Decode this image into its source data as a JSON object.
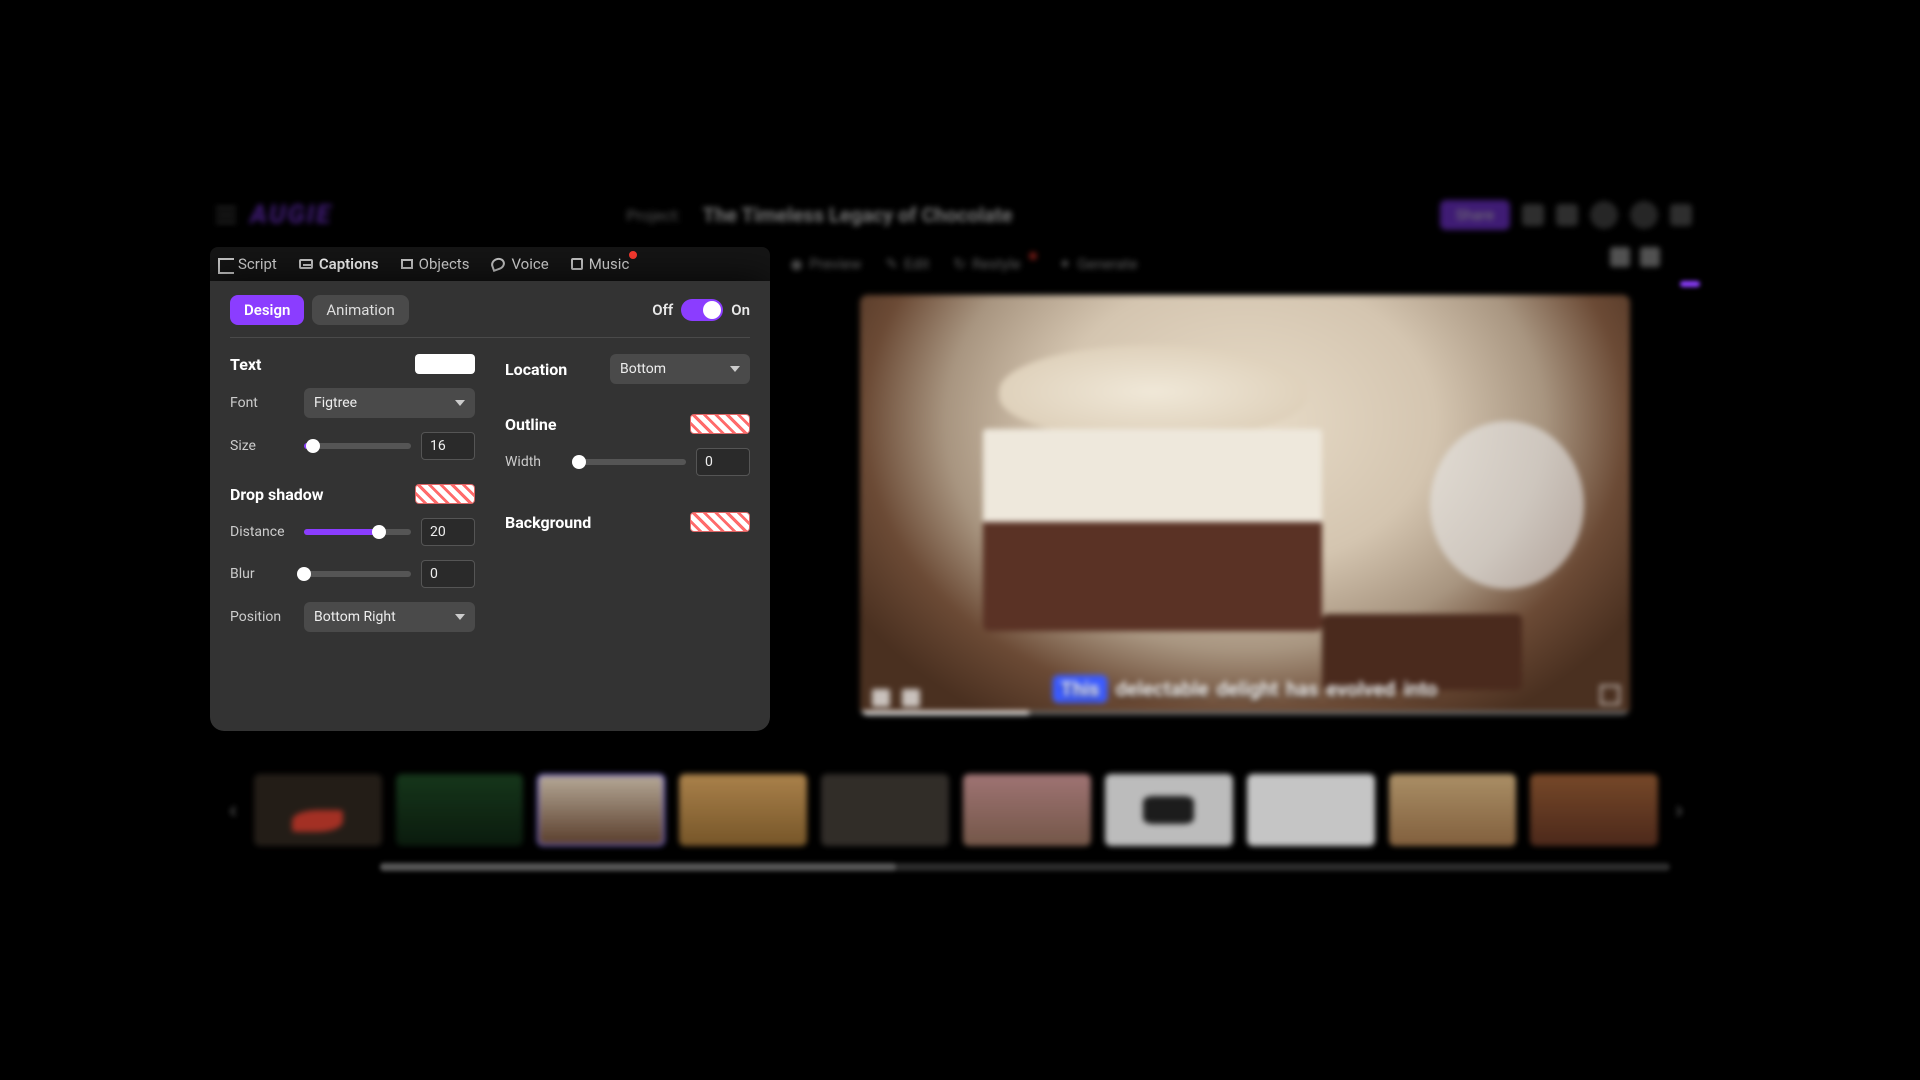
{
  "header": {
    "logo": "AUGIE",
    "project_label": "Project:",
    "project_title": "The Timeless Legacy of Chocolate",
    "share": "Share"
  },
  "tabs": {
    "script": "Script",
    "captions": "Captions",
    "objects": "Objects",
    "voice": "Voice",
    "music": "Music"
  },
  "preview_tabs": {
    "preview": "Preview",
    "edit": "Edit",
    "restyle": "Restyle",
    "generate": "Generate"
  },
  "panel": {
    "design": "Design",
    "animation": "Animation",
    "toggle_off": "Off",
    "toggle_on": "On",
    "toggle_state": true,
    "text": {
      "title": "Text",
      "font_label": "Font",
      "font_value": "Figtree",
      "size_label": "Size",
      "size_value": "16",
      "size_pct": 8
    },
    "drop_shadow": {
      "title": "Drop shadow",
      "distance_label": "Distance",
      "distance_value": "20",
      "distance_pct": 70,
      "blur_label": "Blur",
      "blur_value": "0",
      "blur_pct": 0,
      "position_label": "Position",
      "position_value": "Bottom Right"
    },
    "location": {
      "title": "Location",
      "value": "Bottom"
    },
    "outline": {
      "title": "Outline",
      "width_label": "Width",
      "width_value": "0",
      "width_pct": 0
    },
    "background": {
      "title": "Background"
    }
  },
  "caption_words": [
    "This",
    "delectable",
    "delight",
    "has",
    "evolved",
    "into"
  ],
  "timeline_nav": {
    "prev": "‹",
    "next": "›"
  }
}
